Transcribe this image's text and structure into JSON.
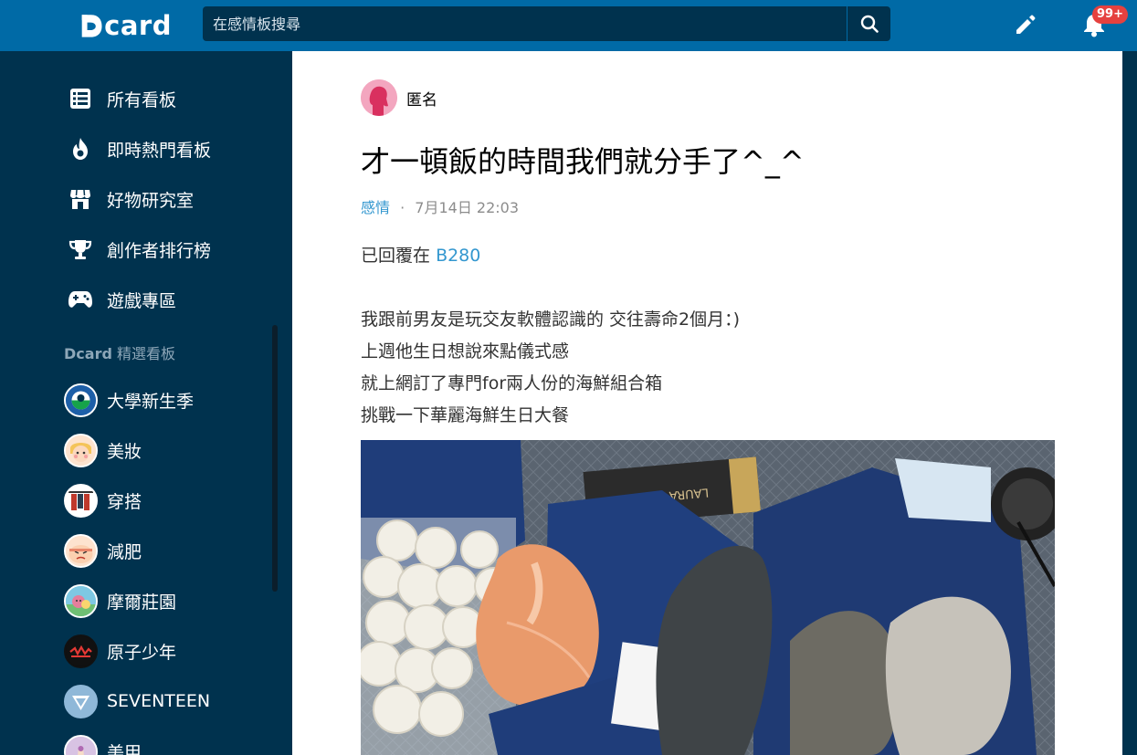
{
  "header": {
    "logo_text": "card",
    "search_placeholder": "在感情板搜尋",
    "notification_badge": "99+",
    "colors": {
      "topbar": "#006aa6",
      "sidebar": "#00324e",
      "badge": "#e5413f",
      "link": "#3397cf"
    }
  },
  "sidebar": {
    "nav_items": [
      {
        "label": "所有看板",
        "icon": "list-icon"
      },
      {
        "label": "即時熱門看板",
        "icon": "fire-icon"
      },
      {
        "label": "好物研究室",
        "icon": "store-icon"
      },
      {
        "label": "創作者排行榜",
        "icon": "trophy-icon"
      },
      {
        "label": "遊戲專區",
        "icon": "gamepad-icon"
      }
    ],
    "section_brand": "Dcard",
    "section_title": "精選看板",
    "boards": [
      {
        "label": "大學新生季"
      },
      {
        "label": "美妝"
      },
      {
        "label": "穿搭"
      },
      {
        "label": "減肥"
      },
      {
        "label": "摩爾莊園"
      },
      {
        "label": "原子少年"
      },
      {
        "label": "SEVENTEEN"
      },
      {
        "label": "美甲"
      }
    ]
  },
  "post": {
    "author": "匿名",
    "title": "才一頓飯的時間我們就分手了^_^",
    "forum": "感情",
    "separator": "·",
    "date": "7月14日 22:03",
    "reply_prefix": "已回覆在",
    "reply_floor": "B280",
    "body_lines": [
      "我跟前男友是玩交友軟體認識的 交往壽命2個月：)",
      "上週他生日想說來點儀式感",
      "就上網訂了專門for兩人份的海鮮組合箱",
      "挑戰一下華麗海鮮生日大餐"
    ],
    "photo_box_text": "LAURA IOIOA"
  }
}
